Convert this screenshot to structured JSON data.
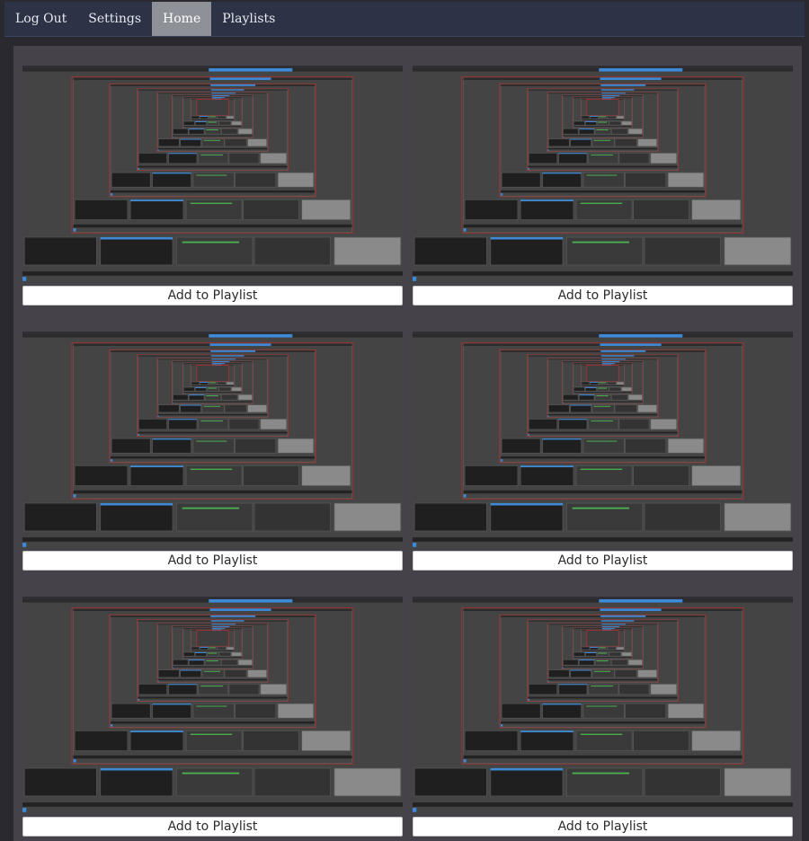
{
  "nav": {
    "items": [
      {
        "label": "Log Out",
        "active": false
      },
      {
        "label": "Settings",
        "active": false
      },
      {
        "label": "Home",
        "active": true
      },
      {
        "label": "Playlists",
        "active": false
      }
    ]
  },
  "grid": {
    "button_label": "Add to Playlist",
    "items": [
      {
        "button_label": "Add to Playlist"
      },
      {
        "button_label": "Add to Playlist"
      },
      {
        "button_label": "Add to Playlist"
      },
      {
        "button_label": "Add to Playlist"
      },
      {
        "button_label": "Add to Playlist"
      },
      {
        "button_label": "Add to Playlist"
      }
    ]
  },
  "colors": {
    "topbar": "#2c3347",
    "active_tab": "#8f9199",
    "panel": "#454349",
    "accent_blue": "#3c8ad8",
    "recording_red": "#b03030"
  }
}
